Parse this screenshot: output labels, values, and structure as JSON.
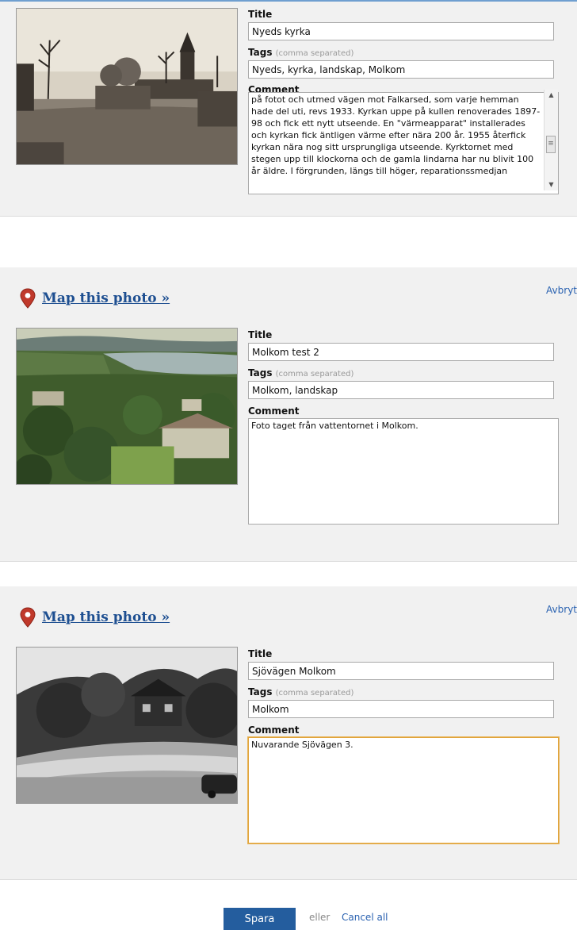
{
  "common": {
    "title_label": "Title",
    "tags_label": "Tags",
    "tags_hint": "(comma separated)",
    "comment_label": "Comment",
    "map_link": "Map this photo »",
    "cancel_link": "Avbryt"
  },
  "photos": [
    {
      "title": "Nyeds kyrka",
      "tags": "Nyeds, kyrka, landskap, Molkom",
      "comment": "på fotot och utmed vägen mot Falkarsed, som varje hemman hade del uti, revs 1933. Kyrkan uppe på kullen renoverades 1897-98 och fick ett nytt utseende. En \"värmeapparat\" installerades och kyrkan fick äntligen värme efter nära 200 år. 1955 återfick kyrkan nära nog sitt ursprungliga utseende. Kyrktornet med stegen upp till klockorna och de gamla lindarna har nu blivit 100 år äldre. I förgrunden, längs till höger, reparationssmedjan"
    },
    {
      "title": "Molkom test 2",
      "tags": "Molkom, landskap",
      "comment": "Foto taget från vattentornet i Molkom."
    },
    {
      "title": "Sjövägen Molkom",
      "tags": "Molkom",
      "comment": "Nuvarande Sjövägen 3."
    }
  ],
  "footer": {
    "save_label": "Spara",
    "or_label": "eller",
    "cancel_all_label": "Cancel all"
  },
  "colors": {
    "link": "#2a62b1",
    "map_link": "#1e4f91",
    "save_button": "#245d9e",
    "panel_bg": "#f1f1f1",
    "pin": "#c0392b",
    "focus_border": "#e0a33a"
  }
}
